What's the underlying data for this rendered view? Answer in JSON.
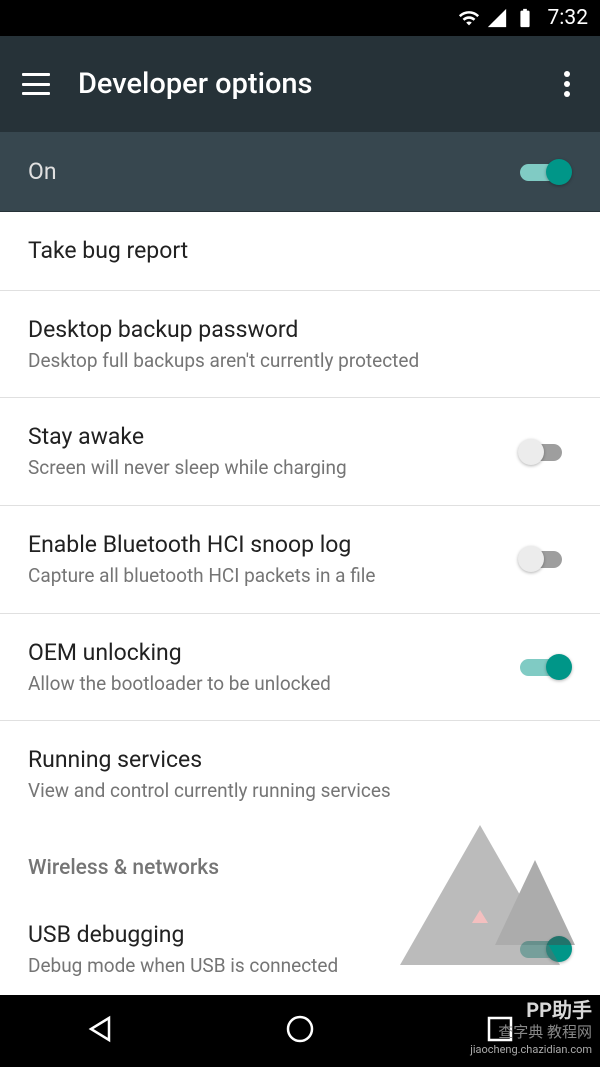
{
  "status": {
    "time": "7:32"
  },
  "header": {
    "title": "Developer options"
  },
  "master": {
    "label": "On",
    "enabled": true
  },
  "items": [
    {
      "title": "Take bug report",
      "sub": null,
      "toggle": null
    },
    {
      "title": "Desktop backup password",
      "sub": "Desktop full backups aren't currently protected",
      "toggle": null
    },
    {
      "title": "Stay awake",
      "sub": "Screen will never sleep while charging",
      "toggle": false
    },
    {
      "title": "Enable Bluetooth HCI snoop log",
      "sub": "Capture all bluetooth HCI packets in a file",
      "toggle": false
    },
    {
      "title": "OEM unlocking",
      "sub": "Allow the bootloader to be unlocked",
      "toggle": true
    },
    {
      "title": "Running services",
      "sub": "View and control currently running services",
      "toggle": null
    }
  ],
  "section": {
    "wireless": "Wireless & networks"
  },
  "usb": {
    "title": "USB debugging",
    "sub": "Debug mode when USB is connected",
    "toggle": true
  },
  "watermark": {
    "brand": "PP助手",
    "site": "查字典 教程网",
    "url": "jiaocheng.chazidian.com"
  }
}
